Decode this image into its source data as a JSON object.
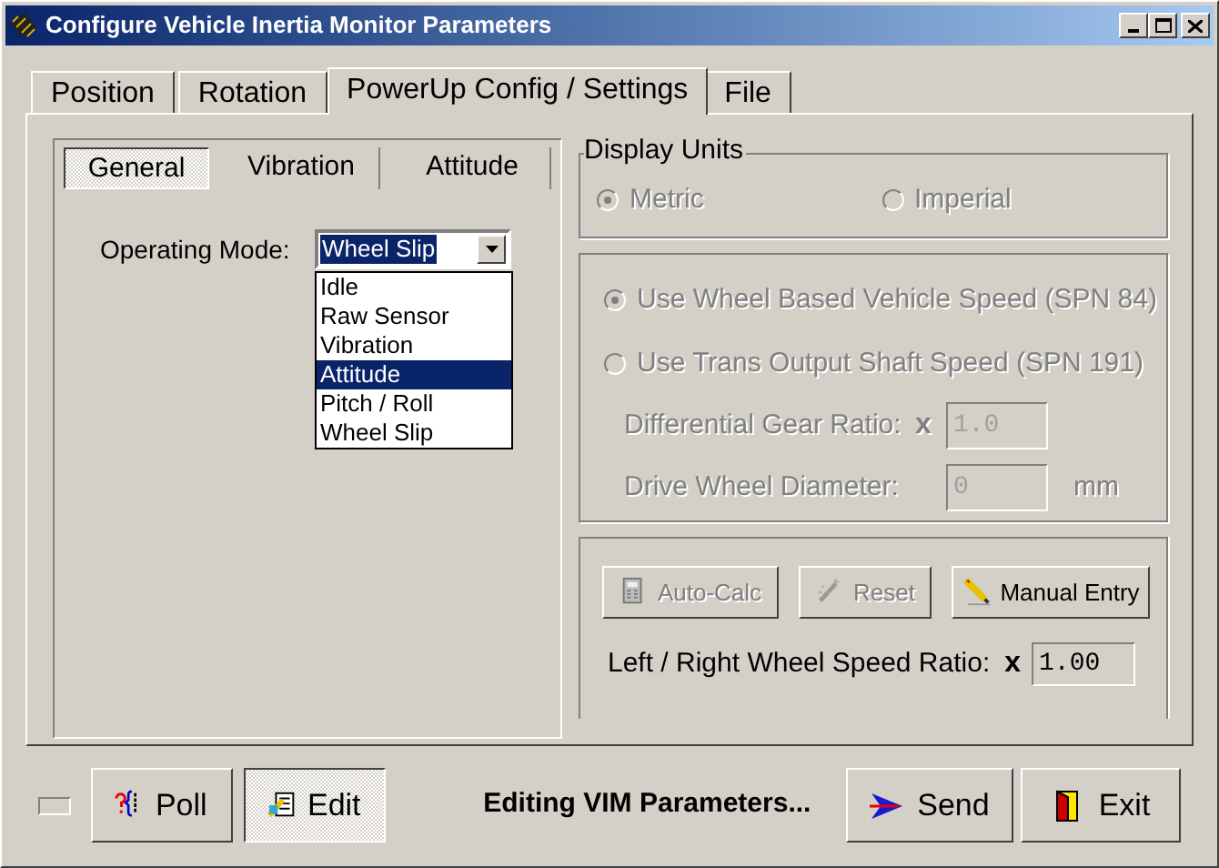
{
  "window": {
    "title": "Configure Vehicle Inertia Monitor Parameters"
  },
  "tabs": [
    {
      "label": "Position",
      "selected": false
    },
    {
      "label": "Rotation",
      "selected": false
    },
    {
      "label": "PowerUp Config / Settings",
      "selected": true
    },
    {
      "label": "File",
      "selected": false
    }
  ],
  "sub_tabs": [
    {
      "label": "General",
      "selected": true
    },
    {
      "label": "Vibration",
      "selected": false
    },
    {
      "label": "Attitude",
      "selected": false
    }
  ],
  "operating_mode": {
    "label": "Operating Mode:",
    "value": "Wheel Slip",
    "expanded": true,
    "options": [
      {
        "label": "Idle",
        "highlighted": false
      },
      {
        "label": "Raw Sensor",
        "highlighted": false
      },
      {
        "label": "Vibration",
        "highlighted": false
      },
      {
        "label": "Attitude",
        "highlighted": true
      },
      {
        "label": "Pitch / Roll",
        "highlighted": false
      },
      {
        "label": "Wheel Slip",
        "highlighted": false
      }
    ]
  },
  "display_units": {
    "title": "Display Units",
    "options": [
      {
        "label": "Metric",
        "selected": true,
        "disabled": true
      },
      {
        "label": "Imperial",
        "selected": false,
        "disabled": true
      }
    ]
  },
  "speed_source": {
    "options": [
      {
        "label": "Use Wheel Based Vehicle Speed (SPN 84)",
        "selected": true,
        "disabled": true
      },
      {
        "label": "Use Trans Output Shaft Speed (SPN 191)",
        "selected": false,
        "disabled": true
      }
    ],
    "fields": [
      {
        "label": "Differential Gear Ratio:",
        "prefix": "x",
        "value": "1.0",
        "disabled": true
      },
      {
        "label": "Drive Wheel Diameter:",
        "value": "0",
        "unit": "mm",
        "disabled": true
      }
    ]
  },
  "calc_buttons": [
    {
      "kind": "calculator",
      "label": "Auto-Calc",
      "disabled": true
    },
    {
      "kind": "wand",
      "label": "Reset",
      "disabled": true
    },
    {
      "kind": "pencil",
      "label": "Manual Entry",
      "disabled": false
    }
  ],
  "wheel_speed_ratio": {
    "label": "Left / Right Wheel Speed Ratio:",
    "prefix": "x",
    "value": "1.00"
  },
  "bottom": {
    "indicator": {
      "on": false
    },
    "buttons": [
      {
        "kind": "poll",
        "label": "Poll",
        "pressed": false
      },
      {
        "kind": "edit",
        "label": "Edit",
        "pressed": true
      }
    ],
    "status": "Editing VIM Parameters...",
    "actions": [
      {
        "kind": "send",
        "label": "Send"
      },
      {
        "kind": "exit",
        "label": "Exit"
      }
    ]
  }
}
